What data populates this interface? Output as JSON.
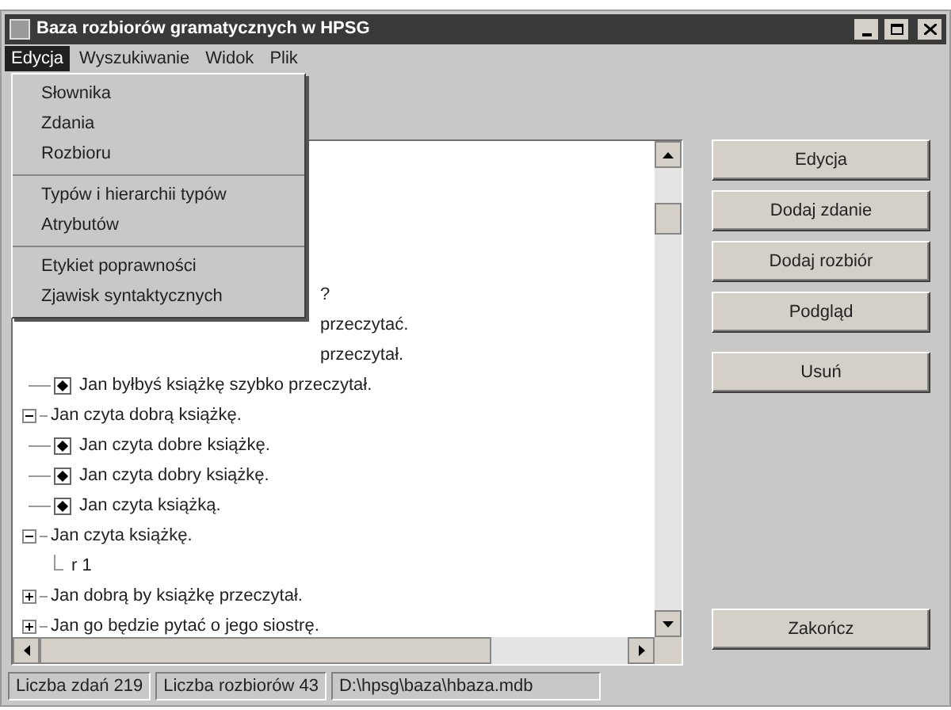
{
  "window": {
    "title": "Baza rozbiorów gramatycznych w HPSG"
  },
  "menu_bar": [
    {
      "label": "Edycja",
      "selected": true
    },
    {
      "label": "Wyszukiwanie",
      "selected": false
    },
    {
      "label": "Widok",
      "selected": false
    },
    {
      "label": "Plik",
      "selected": false
    }
  ],
  "dropdown": {
    "groups": [
      [
        "Słownika",
        "Zdania",
        "Rozbioru"
      ],
      [
        "Typów i hierarchii typów",
        "Atrybutów"
      ],
      [
        "Etykiet poprawności",
        "Zjawisk syntaktycznych"
      ]
    ]
  },
  "tree": [
    {
      "kind": "partial",
      "text": "?"
    },
    {
      "kind": "partial",
      "text": "przeczytać."
    },
    {
      "kind": "partial",
      "text": "przeczytał.",
      "children": [
        {
          "kind": "leaf",
          "text": "Jan byłbyś książkę szybko przeczytał."
        }
      ]
    },
    {
      "kind": "node",
      "text": "Jan czyta dobrą książkę.",
      "expanded": true,
      "children": [
        {
          "kind": "leaf",
          "text": "Jan czyta dobre książkę."
        },
        {
          "kind": "leaf",
          "text": "Jan czyta dobry książkę."
        },
        {
          "kind": "leaf",
          "text": "Jan czyta książką."
        }
      ]
    },
    {
      "kind": "node",
      "text": "Jan czyta książkę.",
      "expanded": true,
      "children": [
        {
          "kind": "plain",
          "text": "r 1"
        }
      ]
    },
    {
      "kind": "node",
      "text": "Jan dobrą by książkę przeczytał.",
      "expanded": false
    },
    {
      "kind": "node",
      "text": "Jan go będzie pytać o jego siostrę.",
      "expanded": false
    }
  ],
  "button_groups": [
    [
      "Edycja",
      "Dodaj zdanie",
      "Dodaj rozbiór",
      "Podgląd"
    ],
    [
      "Usuń"
    ],
    [
      "Zakończ"
    ]
  ],
  "status_bar": [
    "Liczba zdań 219",
    "Liczba rozbiorów 43",
    "D:\\hpsg\\baza\\hbaza.mdb"
  ]
}
